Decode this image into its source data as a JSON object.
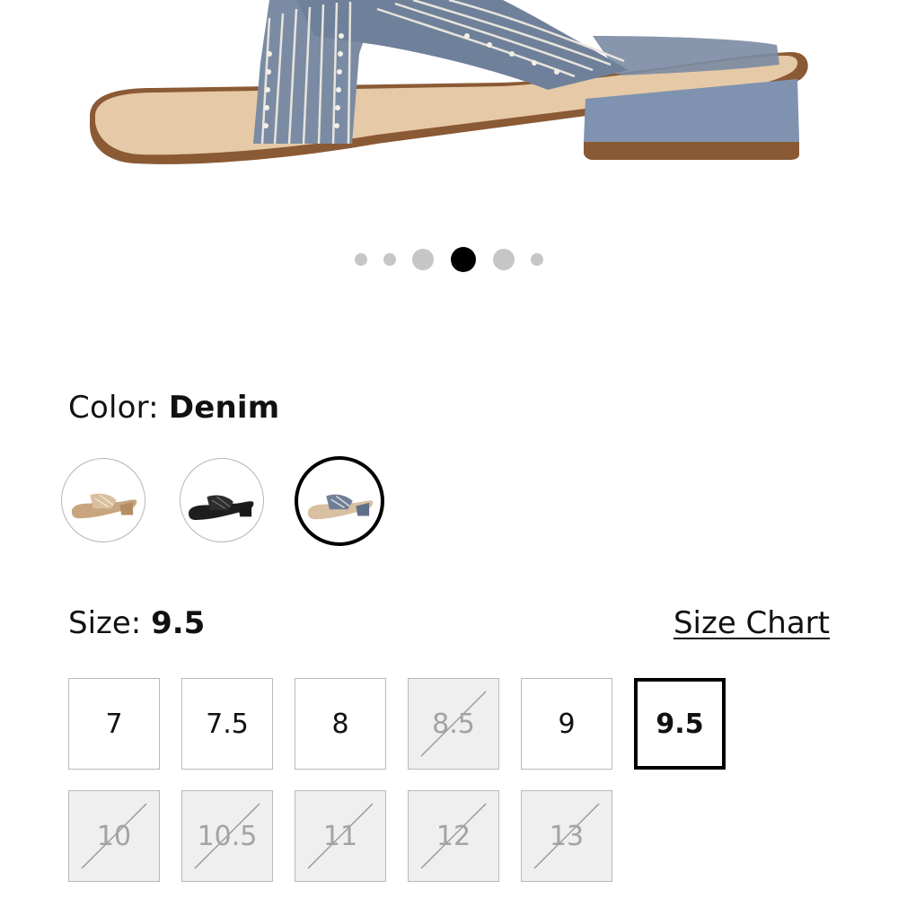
{
  "product": {
    "image_alt": "Denim strappy slide sandal with low block heel, side view",
    "carousel": {
      "count": 6,
      "active_index": 3
    }
  },
  "color": {
    "label": "Color:",
    "selected": "Denim",
    "swatches": [
      {
        "name": "natural-swatch",
        "color": "#d9bfa0"
      },
      {
        "name": "black-swatch",
        "color": "#2a2a2a"
      },
      {
        "name": "denim-swatch",
        "color": "#6f7f95"
      }
    ]
  },
  "size": {
    "label": "Size:",
    "selected": "9.5",
    "chart_link": "Size Chart",
    "options": [
      {
        "label": "7",
        "available": true,
        "selected": false
      },
      {
        "label": "7.5",
        "available": true,
        "selected": false
      },
      {
        "label": "8",
        "available": true,
        "selected": false
      },
      {
        "label": "8.5",
        "available": false,
        "selected": false
      },
      {
        "label": "9",
        "available": true,
        "selected": false
      },
      {
        "label": "9.5",
        "available": true,
        "selected": true
      },
      {
        "label": "10",
        "available": false,
        "selected": false
      },
      {
        "label": "10.5",
        "available": false,
        "selected": false
      },
      {
        "label": "11",
        "available": false,
        "selected": false
      },
      {
        "label": "12",
        "available": false,
        "selected": false
      },
      {
        "label": "13",
        "available": false,
        "selected": false
      }
    ]
  },
  "colors": {
    "denim": "#7a8ba3",
    "denim_dark": "#5f6f88",
    "footbed": "#e6c9a6",
    "sole": "#8a5a35",
    "heel": "#7f93b0",
    "stitch": "#e8e4dc"
  }
}
